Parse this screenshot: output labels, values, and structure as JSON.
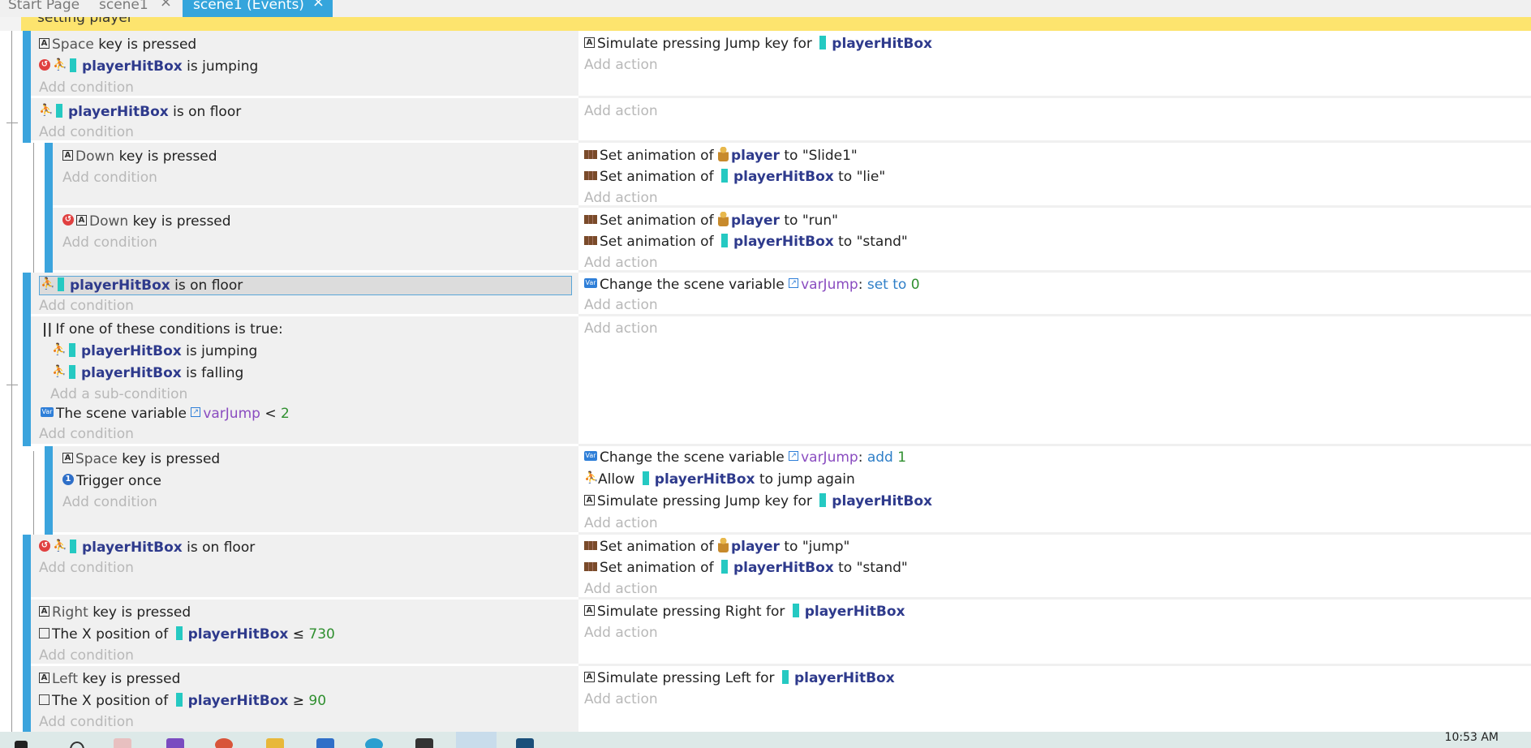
{
  "tabs": [
    {
      "label": "Start Page",
      "closable": false,
      "active": false
    },
    {
      "label": "scene1",
      "closable": true,
      "active": false
    },
    {
      "label": "scene1 (Events)",
      "closable": true,
      "active": true
    }
  ],
  "group": {
    "title": "setting player"
  },
  "common": {
    "add_condition": "Add condition",
    "add_action": "Add action",
    "add_subcondition": "Add a sub-condition",
    "close_glyph": "×"
  },
  "events": {
    "e1": {
      "c1": {
        "key": "Space",
        "rest": "key is pressed"
      },
      "c2": {
        "obj": "playerHitBox",
        "rest": "is jumping"
      },
      "a1": {
        "text": "Simulate pressing Jump key for",
        "obj": "playerHitBox"
      }
    },
    "e2": {
      "c1": {
        "obj": "playerHitBox",
        "rest": "is on floor"
      }
    },
    "e3": {
      "c1": {
        "key": "Down",
        "rest": "key is pressed"
      },
      "a1": {
        "text": "Set animation of",
        "obj": "player",
        "rest": "to \"Slide1\""
      },
      "a2": {
        "text": "Set animation of",
        "obj": "playerHitBox",
        "rest": "to \"lie\""
      }
    },
    "e4": {
      "c1": {
        "key": "Down",
        "rest": "key is pressed"
      },
      "a1": {
        "text": "Set animation of",
        "obj": "player",
        "rest": "to \"run\""
      },
      "a2": {
        "text": "Set animation of",
        "obj": "playerHitBox",
        "rest": "to \"stand\""
      }
    },
    "e5": {
      "c1": {
        "obj": "playerHitBox",
        "rest": "is on floor"
      },
      "a1": {
        "text": "Change the scene variable",
        "var": "varJump",
        "sep": ":",
        "op": "set to",
        "value": "0"
      }
    },
    "e6": {
      "or_label": "If one of these conditions is true:",
      "s1": {
        "obj": "playerHitBox",
        "rest": "is jumping"
      },
      "s2": {
        "obj": "playerHitBox",
        "rest": "is falling"
      },
      "c2": {
        "text": "The scene variable",
        "var": "varJump",
        "cmp": "<",
        "value": "2"
      }
    },
    "e7": {
      "c1": {
        "key": "Space",
        "rest": "key is pressed"
      },
      "c2": {
        "text": "Trigger once"
      },
      "a1": {
        "text": "Change the scene variable",
        "var": "varJump",
        "sep": ":",
        "op": "add",
        "value": "1"
      },
      "a2": {
        "text": "Allow",
        "obj": "playerHitBox",
        "rest": "to jump again"
      },
      "a3": {
        "text": "Simulate pressing Jump key for",
        "obj": "playerHitBox"
      }
    },
    "e8": {
      "c1": {
        "obj": "playerHitBox",
        "rest": "is on floor"
      },
      "a1": {
        "text": "Set animation of",
        "obj": "player",
        "rest": "to \"jump\""
      },
      "a2": {
        "text": "Set animation of",
        "obj": "playerHitBox",
        "rest": "to \"stand\""
      }
    },
    "e9": {
      "c1": {
        "key": "Right",
        "rest": "key is pressed"
      },
      "c2": {
        "text": "The X position of",
        "obj": "playerHitBox",
        "cmp": "≤",
        "value": "730"
      },
      "a1": {
        "text": "Simulate pressing Right for",
        "obj": "playerHitBox"
      }
    },
    "e10": {
      "c1": {
        "key": "Left",
        "rest": "key is pressed"
      },
      "c2": {
        "text": "The X position of",
        "obj": "playerHitBox",
        "cmp": "≥",
        "value": "90"
      },
      "a1": {
        "text": "Simulate pressing Left for",
        "obj": "playerHitBox"
      }
    }
  },
  "icons": {
    "key": "A",
    "inverted": "↺",
    "platformer": "⛹",
    "variable": "Var",
    "var_small": "↗",
    "once": "1",
    "or": "||"
  },
  "taskbar": {
    "time": "10:53 AM"
  },
  "colors": {
    "accent": "#35a5dc",
    "event_bar": "#3ba4dd",
    "group": "#fde46e",
    "object": "#2e3a8c",
    "variable": "#8a4cc0",
    "number": "#2f8f2f"
  }
}
